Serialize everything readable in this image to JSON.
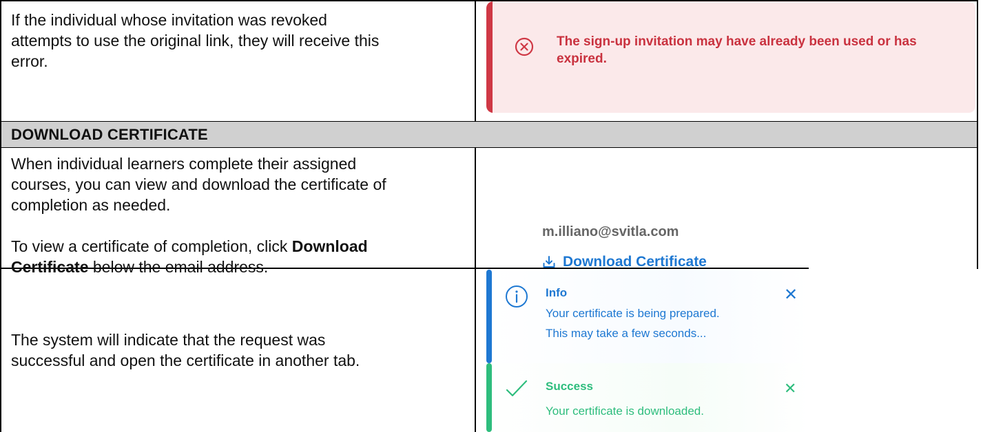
{
  "rows": {
    "revoked": {
      "description": [
        "If the individual whose invitation was revoked",
        "attempts to use the original link, they will receive this",
        "error."
      ],
      "error_toast": {
        "icon": "circle-x-icon",
        "message_line1": "The sign-up invitation may have already been used or has",
        "message_line2": "expired."
      }
    },
    "section_header": "DOWNLOAD CERTIFICATE",
    "download": {
      "paragraph1": [
        "When individual learners complete their assigned",
        "courses, you can view and download the certificate of",
        "completion as needed."
      ],
      "paragraph2_prefix": "To view a certificate of completion, click ",
      "paragraph2_bold_1": "Download",
      "paragraph2_bold_2": "Certificate",
      "paragraph2_suffix": " below the email address.",
      "email": "m.illiano@svitla.com",
      "link_label": "Download Certificate",
      "link_icon": "download-icon"
    },
    "notify": {
      "description": [
        "The system will indicate that the request was",
        "successful and open the certificate in another tab."
      ],
      "info_toast": {
        "icon": "info-circle-icon",
        "title": "Info",
        "line1": "Your certificate is being prepared.",
        "line2": "This may take a few seconds...",
        "close_icon": "close-icon"
      },
      "success_toast": {
        "icon": "checkmark-icon",
        "title": "Success",
        "line1": "Your certificate is downloaded.",
        "close_icon": "close-icon"
      }
    }
  },
  "colors": {
    "error": "#cf3845",
    "error_bg": "#fbe9ea",
    "header_bg": "#d0d0d0",
    "info": "#1e78d2",
    "success": "#2ebd7d"
  }
}
